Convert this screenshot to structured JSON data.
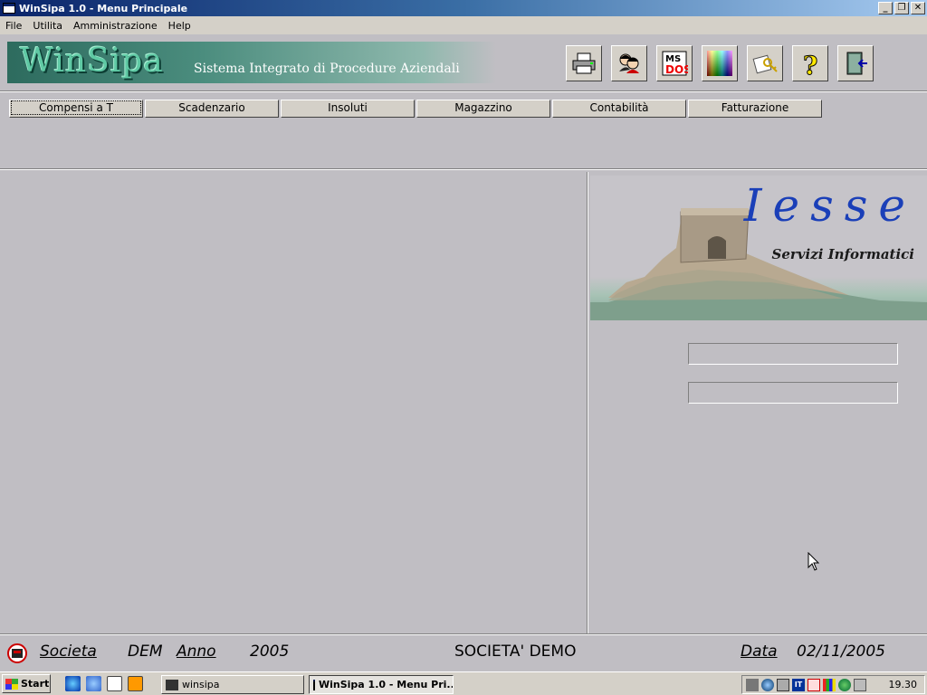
{
  "window": {
    "title": "WinSipa 1.0 - Menu Principale"
  },
  "menu": [
    "File",
    "Utilita",
    "Amministrazione",
    "Help"
  ],
  "banner": {
    "logo": "WinSipa",
    "subtitle": "Sistema Integrato di Procedure Aziendali"
  },
  "toolbar": [
    "printer-icon",
    "users-icon",
    "msdos-icon",
    "color-palette-icon",
    "keys-icon",
    "help-icon",
    "exit-door-icon"
  ],
  "modules": [
    "Compensi a T",
    "Scadenzario",
    "Insoluti",
    "Magazzino",
    "Contabilità",
    "Fatturazione"
  ],
  "brand": {
    "name": "Iesse",
    "subtitle": "Servizi Informatici"
  },
  "status": {
    "societa_label": "Societa",
    "societa_code": "DEM",
    "anno_label": "Anno",
    "anno_value": "2005",
    "company_name": "SOCIETA' DEMO",
    "data_label": "Data",
    "data_value": "02/11/2005"
  },
  "taskbar": {
    "start": "Start",
    "tasks": [
      "winsipa",
      "WinSipa 1.0 - Menu Pri..."
    ],
    "clock": "19.30"
  }
}
